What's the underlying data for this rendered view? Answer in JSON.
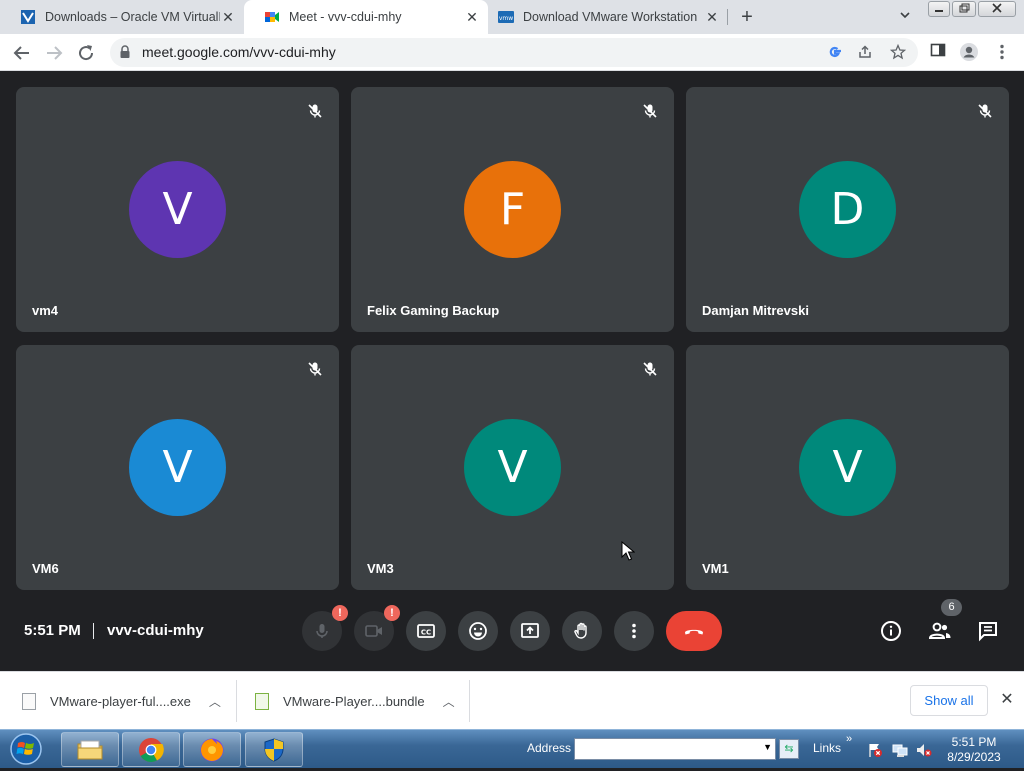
{
  "browser": {
    "tabs": [
      {
        "title": "Downloads – Oracle VM VirtualB",
        "active": false
      },
      {
        "title": "Meet - vvv-cdui-mhy",
        "active": true
      },
      {
        "title": "Download VMware Workstation",
        "active": false
      }
    ],
    "new_tab_label": "+",
    "url": "meet.google.com/vvv-cdui-mhy"
  },
  "meet": {
    "participants": [
      {
        "name": "vm4",
        "initial": "V",
        "color": "#5e35b1",
        "muted": true
      },
      {
        "name": "Felix Gaming Backup",
        "initial": "F",
        "color": "#e8710a",
        "muted": true
      },
      {
        "name": "Damjan Mitrevski",
        "initial": "D",
        "color": "#00897b",
        "muted": true
      },
      {
        "name": "VM6",
        "initial": "V",
        "color": "#1a8ad4",
        "muted": true
      },
      {
        "name": "VM3",
        "initial": "V",
        "color": "#00897b",
        "muted": true
      },
      {
        "name": "VM1",
        "initial": "V",
        "color": "#00897b",
        "muted": false
      }
    ],
    "time": "5:51 PM",
    "separator": "|",
    "meeting_code": "vvv-cdui-mhy",
    "controls": {
      "mic_warning": "!",
      "cam_warning": "!"
    },
    "people_count": "6"
  },
  "downloads": {
    "items": [
      {
        "name": "VMware-player-ful....exe"
      },
      {
        "name": "VMware-Player....bundle"
      }
    ],
    "show_all_label": "Show all"
  },
  "taskbar": {
    "address_label": "Address",
    "address_value": "",
    "links_label": "Links",
    "links_more": "»",
    "clock_time": "5:51 PM",
    "clock_date": "8/29/2023"
  }
}
